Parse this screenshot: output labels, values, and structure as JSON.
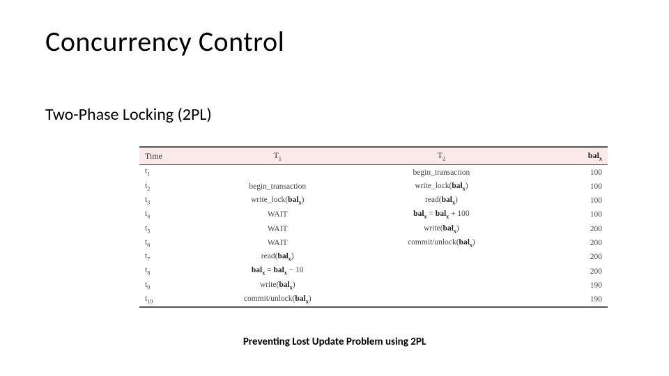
{
  "title": "Concurrency Control",
  "subtitle": "Two-Phase Locking (2PL)",
  "caption": "Preventing Lost Update Problem using 2PL",
  "table": {
    "headers": {
      "time": "Time",
      "t1": "T₁",
      "t2": "T₂",
      "bal": "balₓ"
    },
    "rows": [
      {
        "time": "t₁",
        "t1": "",
        "t2": "begin_transaction",
        "bal": "100"
      },
      {
        "time": "t₂",
        "t1": "begin_transaction",
        "t2": "write_lock(balₓ)",
        "bal": "100"
      },
      {
        "time": "t₃",
        "t1": "write_lock(balₓ)",
        "t2": "read(balₓ)",
        "bal": "100"
      },
      {
        "time": "t₄",
        "t1": "WAIT",
        "t2": "balₓ = balₓ + 100",
        "bal": "100"
      },
      {
        "time": "t₅",
        "t1": "WAIT",
        "t2": "write(balₓ)",
        "bal": "200"
      },
      {
        "time": "t₆",
        "t1": "WAIT",
        "t2": "commit/unlock(balₓ)",
        "bal": "200"
      },
      {
        "time": "t₇",
        "t1": "read(balₓ)",
        "t2": "",
        "bal": "200"
      },
      {
        "time": "t₈",
        "t1": "balₓ = balₓ − 10",
        "t2": "",
        "bal": "200"
      },
      {
        "time": "t₉",
        "t1": "write(balₓ)",
        "t2": "",
        "bal": "190"
      },
      {
        "time": "t₁₀",
        "t1": "commit/unlock(balₓ)",
        "t2": "",
        "bal": "190"
      }
    ]
  }
}
